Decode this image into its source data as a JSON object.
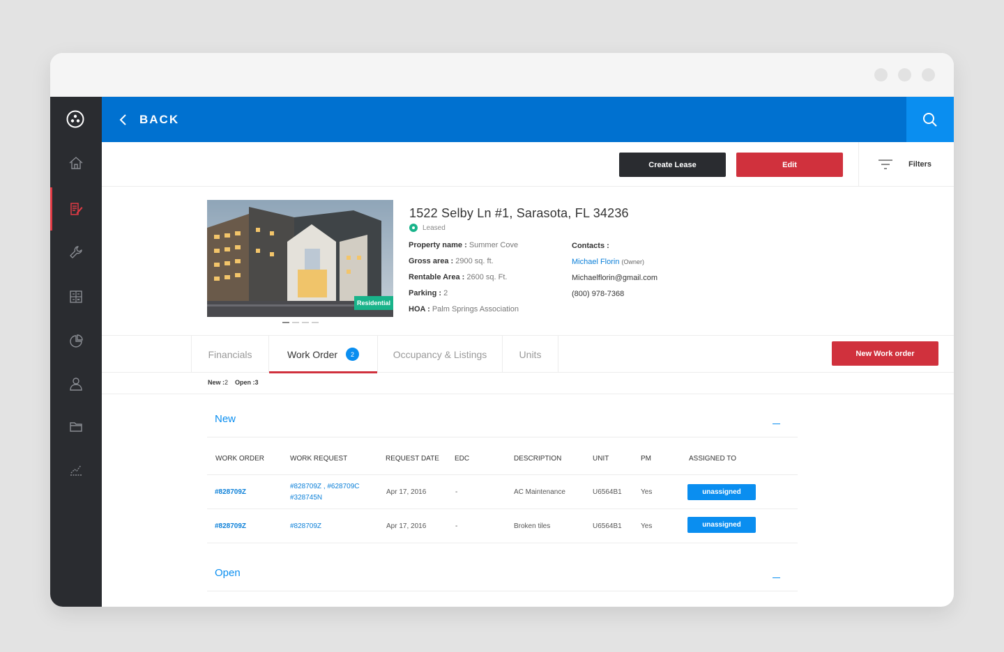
{
  "topbar": {
    "back_label": "BACK"
  },
  "toolbar": {
    "create_lease_label": "Create Lease",
    "edit_label": "Edit",
    "filters_label": "Filters"
  },
  "property": {
    "address": "1522 Selby Ln #1, Sarasota, FL 34236",
    "status": "Leased",
    "badge": "Residential",
    "details": [
      {
        "label": "Property name :",
        "value": "Summer Cove"
      },
      {
        "label": "Gross area :",
        "value": "2900 sq. ft."
      },
      {
        "label": "Rentable Area :",
        "value": "2600 sq. Ft."
      },
      {
        "label": "Parking :",
        "value": "2"
      },
      {
        "label": "HOA :",
        "value": "Palm Springs Association"
      }
    ],
    "contacts": {
      "label": "Contacts :",
      "name": "Michael Florin",
      "role": "(Owner)",
      "email": "Michaelflorin@gmail.com",
      "phone": "(800) 978-7368"
    }
  },
  "tabs": [
    {
      "label": "Financials"
    },
    {
      "label": "Work Order",
      "badge": "2"
    },
    {
      "label": "Occupancy & Listings"
    },
    {
      "label": "Units"
    }
  ],
  "new_work_order_label": "New Work order",
  "subcounts": {
    "new_label": "New :",
    "new_value": "2",
    "open_label": "Open :",
    "open_value": "3"
  },
  "sections": {
    "new_title": "New",
    "open_title": "Open"
  },
  "table": {
    "columns": [
      "WORK ORDER",
      "WORK REQUEST",
      "REQUEST DATE",
      "EDC",
      "DESCRIPTION",
      "UNIT",
      "PM",
      "ASSIGNED TO"
    ],
    "rows": [
      {
        "work_order": "#828709Z",
        "work_request_1": "#828709Z , #628709C",
        "work_request_2": "#328745N",
        "request_date": "Apr 17, 2016",
        "edc": "-",
        "description": "AC Maintenance",
        "unit": "U6564B1",
        "pm": "Yes",
        "assigned": "unassigned"
      },
      {
        "work_order": "#828709Z",
        "work_request_1": "#828709Z",
        "work_request_2": "",
        "request_date": "Apr 17, 2016",
        "edc": "-",
        "description": "Broken tiles",
        "unit": "U6564B1",
        "pm": "Yes",
        "assigned": "unassigned"
      }
    ]
  },
  "colors": {
    "primary_blue": "#0071d0",
    "accent_blue": "#0a8ef0",
    "red": "#d0313d",
    "sidebar": "#2a2c30",
    "green": "#19b38a"
  }
}
